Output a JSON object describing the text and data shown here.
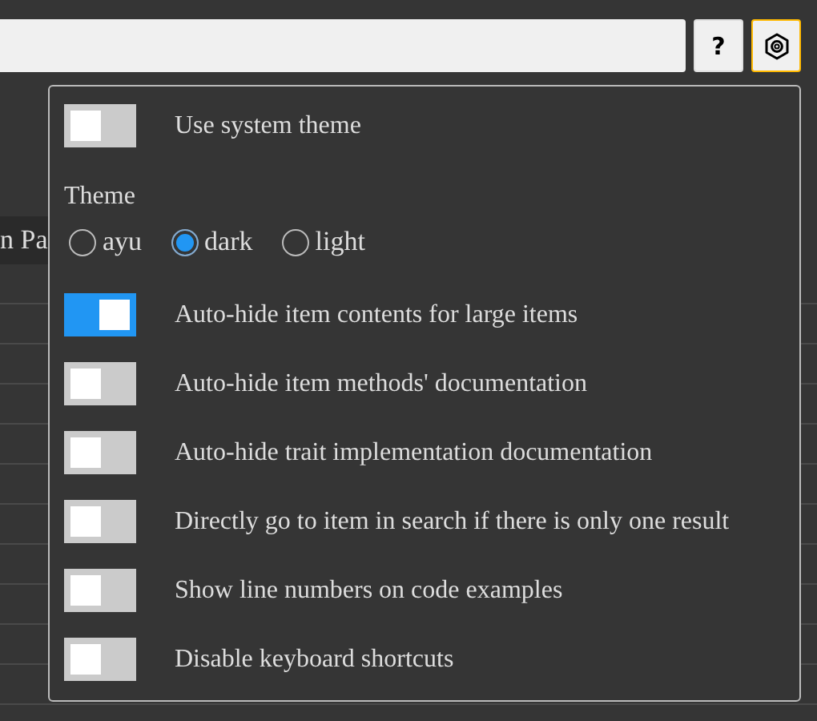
{
  "search": {
    "help_button": "?"
  },
  "background": {
    "heading": "n Pa"
  },
  "settings": {
    "toggles": [
      {
        "label": "Use system theme",
        "on": false
      }
    ],
    "theme": {
      "label": "Theme",
      "options": [
        {
          "label": "ayu",
          "selected": false
        },
        {
          "label": "dark",
          "selected": true
        },
        {
          "label": "light",
          "selected": false
        }
      ]
    },
    "more_toggles": [
      {
        "label": "Auto-hide item contents for large items",
        "on": true
      },
      {
        "label": "Auto-hide item methods' documentation",
        "on": false
      },
      {
        "label": "Auto-hide trait implementation documentation",
        "on": false
      },
      {
        "label": "Directly go to item in search if there is only one result",
        "on": false
      },
      {
        "label": "Show line numbers on code examples",
        "on": false
      },
      {
        "label": "Disable keyboard shortcuts",
        "on": false
      }
    ]
  }
}
